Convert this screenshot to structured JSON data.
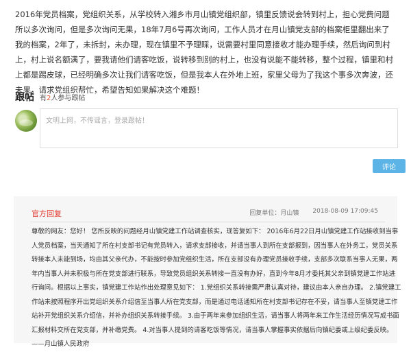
{
  "post": {
    "content": "2016年党员档案，党组织关系，从学校转入湘乡市月山镇党组织部，镇里反馈说会转到村上，担心党费问题所以多次询问，但是多次询问无果，18年7月6号再次询问，工作人员才在月山镇党支部的档案柜里翻出来了我的档案，2年了，未拆封，未办理，现在镇里不予理睬，说需要村里同意接收才能办理手续，然后询问到村上，村上说名额满了，要我请他们请客吃饭，说转移到别的村上，也没有说能不能转移，整个过程，镇里和村上都是踢皮球，已经明确多次让我们请客吃饭，但是我本人在外地上班，家里父母为了我这个事多次奔波，还未果，请求党组织帮忙，希望告知如果解决这个难题！"
  },
  "follow": {
    "title": "跟帖",
    "count_prefix": "有",
    "count": "2",
    "count_suffix": "人参与跟帖"
  },
  "comment": {
    "placeholder": "文明上网，不传谣言，登录跟帖！",
    "submit_label": "评论"
  },
  "reply": {
    "label": "官方回复",
    "unit_label": "回复单位：月山镇",
    "time": "2018-08-09 17:09:45",
    "content": "尊敬的网友：您好！ 您所反映的问题经月山镇党建工作站调查核实，现答复如下： 2016年6月22日月山镇党建工作站接收到当事人党员档案，当天通知了所在村支部书记有党员转入，请求支部接收，并请当事人到所在支部报到，因当事人在外务工，党员关系转接本人未能到场，均由其父亲代办，不能按时参加党组织生活，所在支部没有办理党员接收手续，支部多次联系当事人无果，两年内当事人并未积极与所在党支部进行联系，导致党员组织关系转接一直没有办好，直到今年8月才委托其父亲到镇党建工作站进行询问。根据以上事实，镇党建工作站作出处理意见如下： 1.党组织关系转接需严肃认真对待，建议由本人亲自办理。 2.镇党建工作站未按照程序开出党组织关系介绍信至当事人所在党支部，而是通过电话通知所在村支部书记存在不妥，请当事人至镇党建工作站补开党组织关系介绍信，并补办组织关系转接手续。 3.由于两年来参加组织生活，请当事人将两年来工作生活经历情况写成书面汇报材料交所在党支部，并补缴党费。 4.对当事人提到的请客吃饭等情况，请当事人掌握事实依据后向镇纪委或上级纪委反映。——月山镇人民政府"
  }
}
